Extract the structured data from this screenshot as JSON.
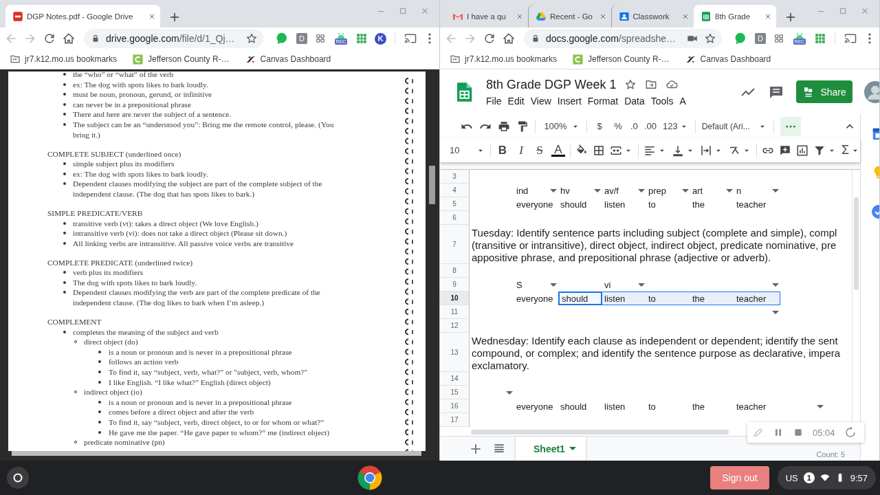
{
  "windows": [
    {
      "tabs": [
        {
          "kind": "pdf",
          "title": "DGP Notes.pdf - Google Drive",
          "selected": true
        }
      ],
      "address": {
        "host": "drive.google.com",
        "path": "/file/d/1_Qj…",
        "camera": false
      },
      "extensions": [
        {
          "kind": "bubble"
        },
        {
          "kind": "letter",
          "label": "D"
        },
        {
          "kind": "apps"
        },
        {
          "kind": "rec",
          "label": "REC"
        },
        {
          "kind": "sheet"
        },
        {
          "kind": "k",
          "label": "K"
        }
      ],
      "bookmarks": [
        {
          "kind": "folder",
          "label": "jr7.k12.mo.us bookmarks"
        },
        {
          "kind": "c",
          "label": "Jefferson County R-…"
        },
        {
          "kind": "canvas",
          "label": "Canvas Dashboard"
        }
      ]
    },
    {
      "tabs": [
        {
          "kind": "gmail",
          "title": "I have a qu",
          "selected": false
        },
        {
          "kind": "drive",
          "title": "Recent - Go",
          "selected": false
        },
        {
          "kind": "classroom",
          "title": "Classwork",
          "selected": false
        },
        {
          "kind": "sheets",
          "title": "8th Grade",
          "selected": true
        }
      ],
      "address": {
        "host": "docs.google.com",
        "path": "/spreadshe…",
        "camera": true
      },
      "extensions": [
        {
          "kind": "bubble"
        },
        {
          "kind": "letter",
          "label": "D"
        },
        {
          "kind": "apps"
        },
        {
          "kind": "rec",
          "label": "REC"
        },
        {
          "kind": "sheet"
        }
      ],
      "bookmarks": [
        {
          "kind": "folder",
          "label": "jr7.k12.mo.us bookmarks"
        },
        {
          "kind": "c",
          "label": "Jefferson County R-…"
        },
        {
          "kind": "canvas",
          "label": "Canvas Dashboard"
        }
      ]
    }
  ],
  "document": {
    "sections": [
      {
        "items": [
          {
            "text": "the “who” or “what” of the verb"
          },
          {
            "text": "ex: The dog with spots likes to bark loudly."
          },
          {
            "text": "must be noun, pronoun, gerund, or infinitive"
          },
          {
            "text": "can never be in a prepositional phrase"
          },
          {
            "text": "There and here are never the subject of a sentence."
          },
          {
            "text": "The subject can be an “understood you”:  Bring me the remote control, please.  (You bring it.)"
          }
        ]
      },
      {
        "heading": "COMPLETE SUBJECT (underlined once)",
        "items": [
          {
            "text": "simple subject plus its modifiers"
          },
          {
            "text": "ex: The dog with spots likes to bark loudly."
          },
          {
            "text": "Dependent clauses modifying the subject are part of the complete subject of the independent clause. (The dog that has spots likes to bark.)"
          }
        ]
      },
      {
        "heading": "SIMPLE PREDICATE/VERB",
        "items": [
          {
            "text": "transitive verb (vt): takes a direct object  (We love English.)"
          },
          {
            "text": "intransitive verb (vi): does not take a direct object  (Please sit down.)"
          },
          {
            "text": "All linking verbs are intransitive. All passive voice verbs are transitive"
          }
        ]
      },
      {
        "heading": "COMPLETE PREDICATE (underlined twice)",
        "items": [
          {
            "text": "verb plus its modifiers"
          },
          {
            "text": "The dog with spots likes to bark loudly."
          },
          {
            "text": "Dependent clauses modifying the verb are part of the complete predicate of the independent clause. (The dog likes to bark when I’m asleep.)"
          }
        ]
      },
      {
        "heading": "COMPLEMENT",
        "items": [
          {
            "text": "completes the meaning of the subject and verb",
            "children": [
              {
                "text": "direct object (do)",
                "children": [
                  {
                    "text": "is a noun or pronoun and is never in a prepositional phrase"
                  },
                  {
                    "text": "follows an action verb"
                  },
                  {
                    "text": "To find it, say “subject, verb, what?” or \"subject, verb, whom?\""
                  },
                  {
                    "text": "I like English. “I like what?” English (direct object)"
                  }
                ]
              },
              {
                "text": "indirect object (io)",
                "children": [
                  {
                    "text": "is a noun or pronoun and is never in a prepositional phrase"
                  },
                  {
                    "text": "comes before a direct object and after the verb"
                  },
                  {
                    "text": "To find it, say “subject, verb, direct object, to or for whom or what?”"
                  },
                  {
                    "text": "He gave me the paper.  “He gave paper to whom?” me (indirect object)"
                  }
                ]
              },
              {
                "text": "predicate nominative (pn)"
              }
            ]
          }
        ]
      }
    ]
  },
  "sheet": {
    "title": "8th Grade DGP Week 1",
    "menus": [
      "File",
      "Edit",
      "View",
      "Insert",
      "Format",
      "Data",
      "Tools",
      "A"
    ],
    "share": "Share",
    "zoom": "100%",
    "currency": "$",
    "percent": "%",
    "decimal_less": ".0",
    "decimal_more": ".00",
    "number_format": "123",
    "font": "Default (Ari...",
    "font_size": "10",
    "text_styles": [
      {
        "kind": "bold",
        "label": "B"
      },
      {
        "kind": "italic",
        "label": "I"
      },
      {
        "kind": "strike",
        "label": "S"
      },
      {
        "kind": "color",
        "label": "A"
      }
    ],
    "functions": "Σ",
    "rows": [
      {
        "number": "3",
        "kind": "blank",
        "selected": false
      },
      {
        "number": "4",
        "kind": "cells",
        "selected": false,
        "cells": [
          null,
          {
            "text": "ind",
            "dropdown": true,
            "selected": false
          },
          {
            "text": "hv",
            "dropdown": true,
            "selected": false
          },
          {
            "text": "av/f",
            "dropdown": true,
            "selected": false
          },
          {
            "text": "prep",
            "dropdown": true,
            "selected": false
          },
          {
            "text": "art",
            "dropdown": true,
            "selected": false
          },
          {
            "text": "n",
            "dropdown": true,
            "selected": false
          }
        ]
      },
      {
        "number": "5",
        "kind": "cells",
        "selected": false,
        "cells": [
          null,
          {
            "text": "everyone",
            "dropdown": false,
            "selected": false
          },
          {
            "text": "should",
            "dropdown": false,
            "selected": false
          },
          {
            "text": "listen",
            "dropdown": false,
            "selected": false
          },
          {
            "text": "to",
            "dropdown": false,
            "selected": false
          },
          {
            "text": "the",
            "dropdown": false,
            "selected": false
          },
          {
            "text": "teacher",
            "dropdown": false,
            "selected": false
          }
        ]
      },
      {
        "number": "6",
        "kind": "blank",
        "selected": false
      },
      {
        "number": "7",
        "kind": "note",
        "selected": false,
        "lines": [
          "Tuesday: Identify sentence parts including subject (complete and simple), compl",
          "(transitive or intransitive), direct object, indirect object, predicate nominative, pre",
          "appositive phrase, and prepositional phrase (adjective or adverb)."
        ]
      },
      {
        "number": "8",
        "kind": "blank",
        "selected": false
      },
      {
        "number": "9",
        "kind": "cells",
        "selected": false,
        "cells": [
          null,
          {
            "text": "S",
            "dropdown": true,
            "selected": false
          },
          null,
          {
            "text": "vi",
            "dropdown": true,
            "selected": false
          },
          null,
          null,
          {
            "dropdown": true,
            "selected": false
          }
        ]
      },
      {
        "number": "10",
        "kind": "cells",
        "selected": true,
        "cells": [
          null,
          {
            "text": "everyone",
            "dropdown": false,
            "selected": false,
            "active": false
          },
          {
            "text": "should",
            "dropdown": false,
            "selected": true,
            "active": true
          },
          {
            "text": "listen",
            "dropdown": false,
            "selected": true,
            "active": false
          },
          {
            "text": "to",
            "dropdown": false,
            "selected": true,
            "active": false
          },
          {
            "text": "the",
            "dropdown": false,
            "selected": true,
            "active": false
          },
          {
            "text": "teacher",
            "dropdown": false,
            "selected": true,
            "active": false
          }
        ]
      },
      {
        "number": "11",
        "kind": "cells",
        "selected": false,
        "cells": [
          null,
          null,
          null,
          null,
          null,
          null,
          {
            "dropdown": true,
            "selected": false
          }
        ]
      },
      {
        "number": "12",
        "kind": "blank",
        "selected": false
      },
      {
        "number": "13",
        "kind": "note",
        "selected": false,
        "lines": [
          "Wednesday: Identify each clause as independent or dependent; identify the sent",
          "compound, or complex; and identify the sentence purpose as declarative, impera",
          "exclamatory."
        ]
      },
      {
        "number": "14",
        "kind": "blank",
        "selected": false
      },
      {
        "number": "15",
        "kind": "cells",
        "selected": false,
        "cells": [
          {
            "dropdown": true,
            "selected": false
          }
        ]
      },
      {
        "number": "16",
        "kind": "cells",
        "selected": false,
        "cells": [
          null,
          {
            "text": "everyone",
            "dropdown": false,
            "selected": false
          },
          {
            "text": "should",
            "dropdown": false,
            "selected": false
          },
          {
            "text": "listen",
            "dropdown": false,
            "selected": false
          },
          {
            "text": "to",
            "dropdown": false,
            "selected": false
          },
          {
            "text": "the",
            "dropdown": false,
            "selected": false
          },
          {
            "text": "teacher",
            "dropdown": false,
            "selected": false
          },
          {
            "dropdown": true,
            "selected": false
          }
        ]
      },
      {
        "number": "17",
        "kind": "blank",
        "selected": false
      }
    ],
    "sheet_tabs": [
      {
        "label": "Sheet1",
        "selected": true
      }
    ],
    "status": "Count: 5"
  },
  "recorder": {
    "time": "05:04"
  },
  "shelf": {
    "sign_out": "Sign out",
    "input_method": "US",
    "notification_count": "1",
    "time": "9:57"
  }
}
